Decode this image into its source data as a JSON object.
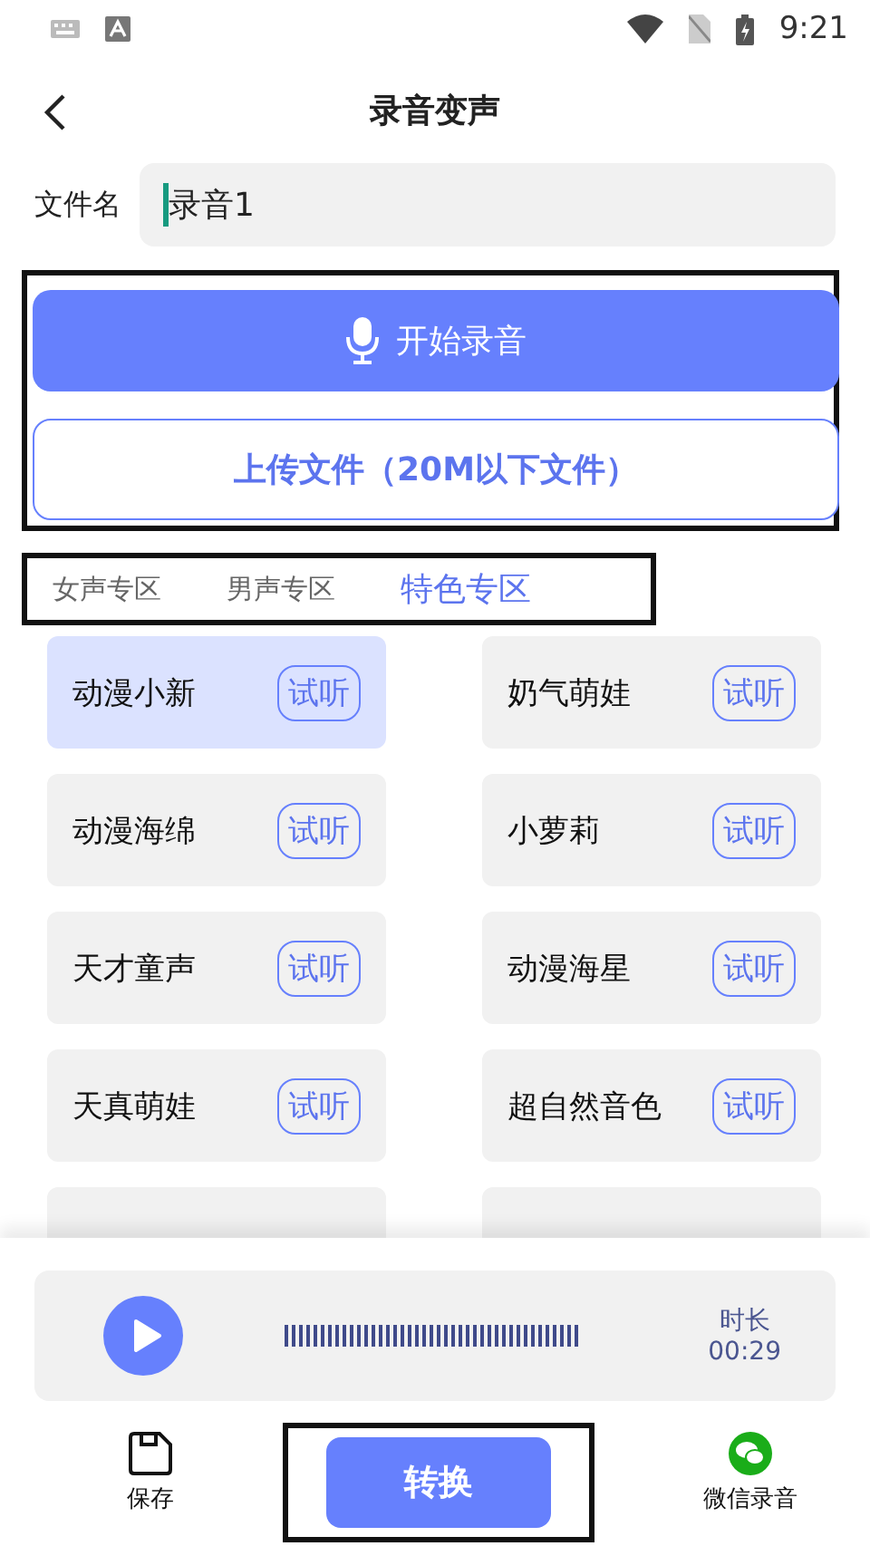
{
  "status_bar": {
    "time": "9:21"
  },
  "header": {
    "title": "录音变声"
  },
  "file_name": {
    "label": "文件名",
    "value": "录音1"
  },
  "record_button": "开始录音",
  "upload_button": "上传文件（20M以下文件）",
  "tabs": [
    {
      "label": "女声专区",
      "selected": false
    },
    {
      "label": "男声专区",
      "selected": false
    },
    {
      "label": "特色专区",
      "selected": true
    }
  ],
  "voices": [
    {
      "name": "动漫小新",
      "preview": "试听",
      "selected": true
    },
    {
      "name": "奶气萌娃",
      "preview": "试听",
      "selected": false
    },
    {
      "name": "动漫海绵",
      "preview": "试听",
      "selected": false
    },
    {
      "name": "小萝莉",
      "preview": "试听",
      "selected": false
    },
    {
      "name": "天才童声",
      "preview": "试听",
      "selected": false
    },
    {
      "name": "动漫海星",
      "preview": "试听",
      "selected": false
    },
    {
      "name": "天真萌娃",
      "preview": "试听",
      "selected": false
    },
    {
      "name": "超自然音色",
      "preview": "试听",
      "selected": false
    }
  ],
  "partial_row": [
    {
      "kind": "voice-card"
    },
    {
      "kind": "voice-card"
    }
  ],
  "player": {
    "duration_label": "时长",
    "duration": "00:29"
  },
  "bottom_bar": {
    "save": "保存",
    "convert": "转换",
    "wechat": "微信录音"
  }
}
